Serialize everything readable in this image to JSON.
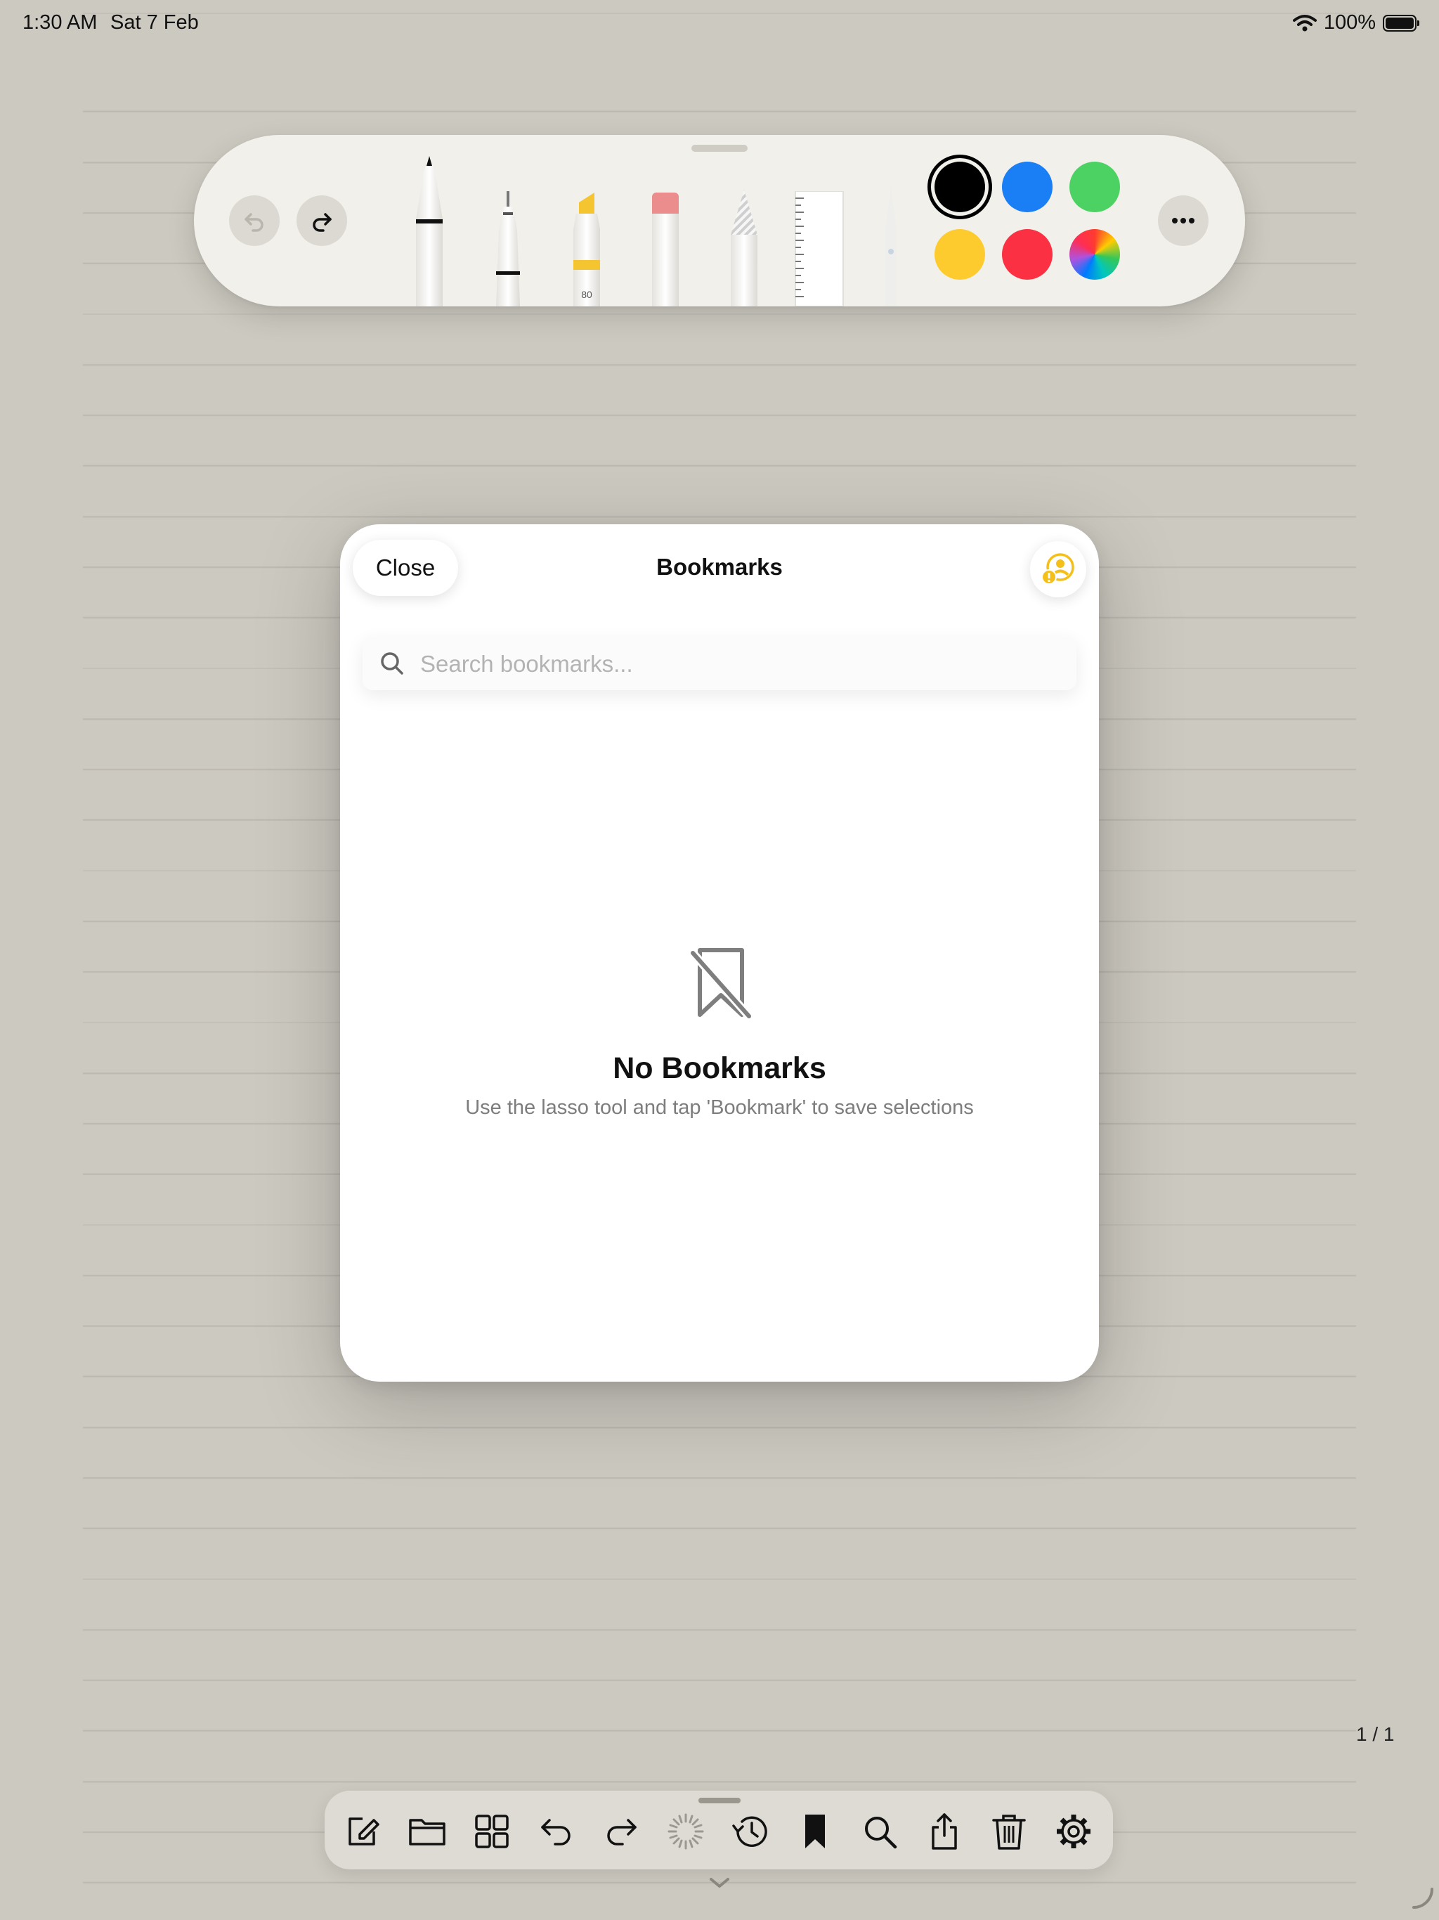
{
  "status_bar": {
    "time": "1:30 AM",
    "date": "Sat 7 Feb",
    "battery_percent": "100%"
  },
  "pen_toolbar": {
    "highlighter_width_label": "80",
    "colors": {
      "black": "#000000",
      "blue": "#1a7ef5",
      "green": "#4cd263",
      "yellow": "#fdcb2e",
      "red": "#fb3042",
      "selected": "black"
    }
  },
  "bookmarks_panel": {
    "close_label": "Close",
    "title": "Bookmarks",
    "search": {
      "placeholder": "Search bookmarks...",
      "value": ""
    },
    "empty_state": {
      "title": "No Bookmarks",
      "subtitle": "Use the lasso tool and tap 'Bookmark' to save selections"
    }
  },
  "page_indicator": "1 / 1",
  "bottom_toolbar": {
    "icons": [
      "compose-icon",
      "folder-icon",
      "grid-icon",
      "undo-icon",
      "redo-icon",
      "loading-spinner-icon",
      "history-icon",
      "bookmark-icon",
      "search-icon",
      "share-icon",
      "trash-icon",
      "gear-icon"
    ]
  }
}
